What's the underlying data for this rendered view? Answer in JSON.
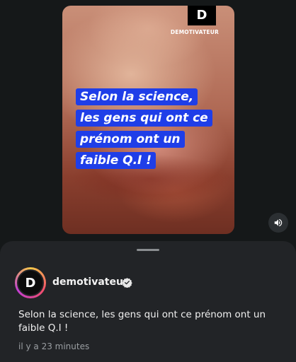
{
  "video": {
    "brand_logo_letter": "D",
    "brand_name": "DEMOTIVATEUR",
    "caption_lines": [
      "Selon la science,",
      "les gens qui ont ce",
      "prénom ont un",
      "faible Q.I !"
    ],
    "caption_highlight_color": "#1f3ee8",
    "sound_icon": "speaker-volume-icon"
  },
  "post": {
    "avatar_letter": "D",
    "username": "demotivateur",
    "verified_icon": "verified-badge-icon",
    "text": "Selon la science, les gens qui ont ce prénom ont un faible Q.I !",
    "timestamp": "il y a 23 minutes"
  }
}
